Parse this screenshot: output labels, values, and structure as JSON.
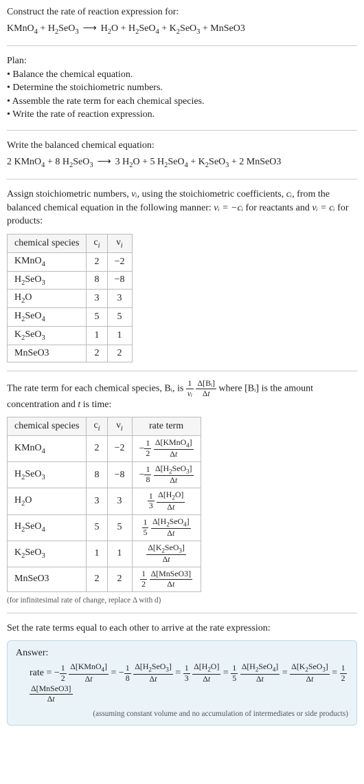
{
  "title": "Construct the rate of reaction expression for:",
  "unbalanced": {
    "reactants": [
      "KMnO₄",
      "H₂SeO₃"
    ],
    "products": [
      "H₂O",
      "H₂SeO₄",
      "K₂SeO₃",
      "MnSeO3"
    ]
  },
  "plan": {
    "heading": "Plan:",
    "items": [
      "Balance the chemical equation.",
      "Determine the stoichiometric numbers.",
      "Assemble the rate term for each chemical species.",
      "Write the rate of reaction expression."
    ]
  },
  "balanced_heading": "Write the balanced chemical equation:",
  "balanced": {
    "reactants": [
      {
        "coef": "2",
        "sp": "KMnO₄"
      },
      {
        "coef": "8",
        "sp": "H₂SeO₃"
      }
    ],
    "products": [
      {
        "coef": "3",
        "sp": "H₂O"
      },
      {
        "coef": "5",
        "sp": "H₂SeO₄"
      },
      {
        "coef": "",
        "sp": "K₂SeO₃"
      },
      {
        "coef": "2",
        "sp": "MnSeO3"
      }
    ]
  },
  "assign_text": {
    "p1": "Assign stoichiometric numbers, ",
    "nu": "νᵢ",
    "p2": ", using the stoichiometric coefficients, ",
    "ci": "cᵢ",
    "p3": ", from the balanced chemical equation in the following manner: ",
    "eq1": "νᵢ = −cᵢ",
    "p4": " for reactants and ",
    "eq2": "νᵢ = cᵢ",
    "p5": " for products:"
  },
  "table1": {
    "headers": [
      "chemical species",
      "cᵢ",
      "νᵢ"
    ],
    "rows": [
      {
        "sp": "KMnO₄",
        "c": "2",
        "nu": "−2"
      },
      {
        "sp": "H₂SeO₃",
        "c": "8",
        "nu": "−8"
      },
      {
        "sp": "H₂O",
        "c": "3",
        "nu": "3"
      },
      {
        "sp": "H₂SeO₄",
        "c": "5",
        "nu": "5"
      },
      {
        "sp": "K₂SeO₃",
        "c": "1",
        "nu": "1"
      },
      {
        "sp": "MnSeO3",
        "c": "2",
        "nu": "2"
      }
    ]
  },
  "rate_term_text": {
    "p1": "The rate term for each chemical species, Bᵢ, is ",
    "p2": " where [Bᵢ] is the amount concentration and ",
    "t": "t",
    "p3": " is time:"
  },
  "table2": {
    "headers": [
      "chemical species",
      "cᵢ",
      "νᵢ",
      "rate term"
    ],
    "rows": [
      {
        "sp": "KMnO₄",
        "c": "2",
        "nu": "−2",
        "sign": "−",
        "f": "2",
        "d": "Δ[KMnO₄]"
      },
      {
        "sp": "H₂SeO₃",
        "c": "8",
        "nu": "−8",
        "sign": "−",
        "f": "8",
        "d": "Δ[H₂SeO₃]"
      },
      {
        "sp": "H₂O",
        "c": "3",
        "nu": "3",
        "sign": "",
        "f": "3",
        "d": "Δ[H₂O]"
      },
      {
        "sp": "H₂SeO₄",
        "c": "5",
        "nu": "5",
        "sign": "",
        "f": "5",
        "d": "Δ[H₂SeO₄]"
      },
      {
        "sp": "K₂SeO₃",
        "c": "1",
        "nu": "1",
        "sign": "",
        "f": "",
        "d": "Δ[K₂SeO₃]"
      },
      {
        "sp": "MnSeO3",
        "c": "2",
        "nu": "2",
        "sign": "",
        "f": "2",
        "d": "Δ[MnSeO3]"
      }
    ]
  },
  "infinitesimal": "(for infinitesimal rate of change, replace Δ with d)",
  "set_equal": "Set the rate terms equal to each other to arrive at the rate expression:",
  "answer": {
    "label": "Answer:",
    "rate_prefix": "rate = ",
    "terms": [
      {
        "sign": "−",
        "f": "2",
        "d": "Δ[KMnO₄]"
      },
      {
        "sign": "−",
        "f": "8",
        "d": "Δ[H₂SeO₃]"
      },
      {
        "sign": "",
        "f": "3",
        "d": "Δ[H₂O]"
      },
      {
        "sign": "",
        "f": "5",
        "d": "Δ[H₂SeO₄]"
      },
      {
        "sign": "",
        "f": "",
        "d": "Δ[K₂SeO₃]"
      },
      {
        "sign": "",
        "f": "2",
        "d": "Δ[MnSeO3]"
      }
    ],
    "assume": "(assuming constant volume and no accumulation of intermediates or side products)"
  },
  "dt": "Δt"
}
